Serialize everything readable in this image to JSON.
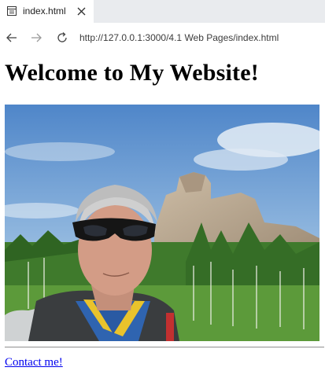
{
  "browser": {
    "tab": {
      "title": "index.html",
      "icon": "page-icon",
      "close_icon": "close-icon"
    },
    "toolbar": {
      "back_icon": "back-arrow-icon",
      "forward_icon": "forward-arrow-icon",
      "reload_icon": "reload-icon",
      "url": "http://127.0.0.1:3000/4.1 Web Pages/index.html"
    }
  },
  "page": {
    "heading": "Welcome to My Website!",
    "image": "selfie-photo",
    "contact_link": "Contact me!"
  },
  "colors": {
    "tab_strip": "#e9ebee",
    "link": "#0000ee",
    "heading": "#000000"
  }
}
